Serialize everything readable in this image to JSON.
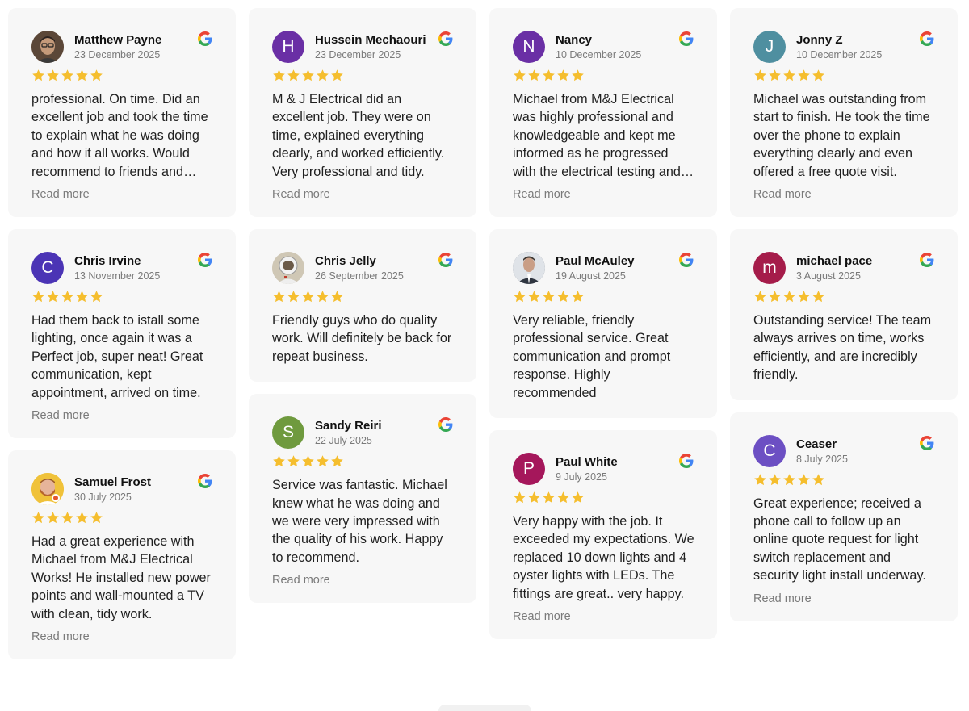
{
  "read_more_label": "Read more",
  "colors": {
    "star": "#F5BE2E",
    "card_bg": "#f7f7f7",
    "date_text": "#7a7a7a"
  },
  "reviews": [
    {
      "name": "Matthew Payne",
      "date": "23 December 2025",
      "avatar_letter": "",
      "avatar_kind": "photo-man-glasses",
      "avatar_color": "#8a6d5a",
      "rating": 5,
      "has_read_more": true,
      "text": "professional. On time. Did an excellent job and took the time to explain what he was doing and how it all works. Would recommend to friends and family."
    },
    {
      "name": "Hussein Mechaouri",
      "date": "23 December 2025",
      "avatar_letter": "H",
      "avatar_kind": "letter",
      "avatar_color": "#6a2fa5",
      "rating": 5,
      "has_read_more": true,
      "text": "M & J Electrical did an excellent job. They were on time, explained everything clearly, and worked efficiently. Very professional and tidy."
    },
    {
      "name": "Nancy",
      "date": "10 December 2025",
      "avatar_letter": "N",
      "avatar_kind": "letter",
      "avatar_color": "#6a2fa5",
      "rating": 5,
      "has_read_more": true,
      "text": "Michael from M&J Electrical was highly professional and knowledgeable and kept me informed as he progressed with the electrical testing and repairs."
    },
    {
      "name": "Jonny Z",
      "date": "10 December 2025",
      "avatar_letter": "J",
      "avatar_kind": "letter",
      "avatar_color": "#4f8fa0",
      "rating": 5,
      "has_read_more": true,
      "text": "Michael was outstanding from start to finish. He took the time over the phone to explain everything clearly and even offered a free quote visit."
    },
    {
      "name": "Chris Irvine",
      "date": "13 November 2025",
      "avatar_letter": "C",
      "avatar_kind": "letter",
      "avatar_color": "#4b34b5",
      "rating": 5,
      "has_read_more": true,
      "text": "Had them back to istall some lighting, once again it was a Perfect job, super neat! Great communication, kept appointment, arrived on time."
    },
    {
      "name": "Chris Jelly",
      "date": "26 September 2025",
      "avatar_letter": "",
      "avatar_kind": "photo-astronaut",
      "avatar_color": "#d9d2c3",
      "rating": 5,
      "has_read_more": false,
      "text": "Friendly guys who do quality work. Will definitely be back for repeat business."
    },
    {
      "name": "Sandy Reiri",
      "date": "22 July 2025",
      "avatar_letter": "S",
      "avatar_kind": "letter",
      "avatar_color": "#6f9a3e",
      "rating": 5,
      "has_read_more": true,
      "text": "Service was fantastic. Michael knew what he was doing and we were very impressed with the quality of his work. Happy to recommend."
    },
    {
      "name": "Paul McAuley",
      "date": "19 August 2025",
      "avatar_letter": "",
      "avatar_kind": "photo-man-suit",
      "avatar_color": "#5a6370",
      "rating": 5,
      "has_read_more": false,
      "text": "Very reliable, friendly professional service. Great communication and prompt response. Highly recommended"
    },
    {
      "name": "Paul White",
      "date": "9 July 2025",
      "avatar_letter": "P",
      "avatar_kind": "letter",
      "avatar_color": "#a5175b",
      "rating": 5,
      "has_read_more": true,
      "text": "Very happy with the job. It exceeded my expectations. We replaced 10 down lights and 4 oyster lights with LEDs. The fittings are great.. very happy."
    },
    {
      "name": "michael pace",
      "date": "3 August 2025",
      "avatar_letter": "m",
      "avatar_kind": "letter",
      "avatar_color": "#a51c4a",
      "rating": 5,
      "has_read_more": false,
      "text": "Outstanding service! The team always arrives on time, works efficiently, and are incredibly friendly."
    },
    {
      "name": "Ceaser",
      "date": "8 July 2025",
      "avatar_letter": "C",
      "avatar_kind": "letter",
      "avatar_color": "#6c4fc3",
      "rating": 5,
      "has_read_more": true,
      "text": "Great experience; received a phone call to follow up an online quote request for light switch replacement and security light install underway."
    },
    {
      "name": "Samuel Frost",
      "date": "30 July 2025",
      "avatar_letter": "",
      "avatar_kind": "photo-man-beard",
      "avatar_color": "#f0c23a",
      "rating": 5,
      "has_read_more": true,
      "text": "Had a great experience with Michael from M&J Electrical Works! He installed new power points and wall-mounted a TV with clean, tidy work."
    }
  ]
}
